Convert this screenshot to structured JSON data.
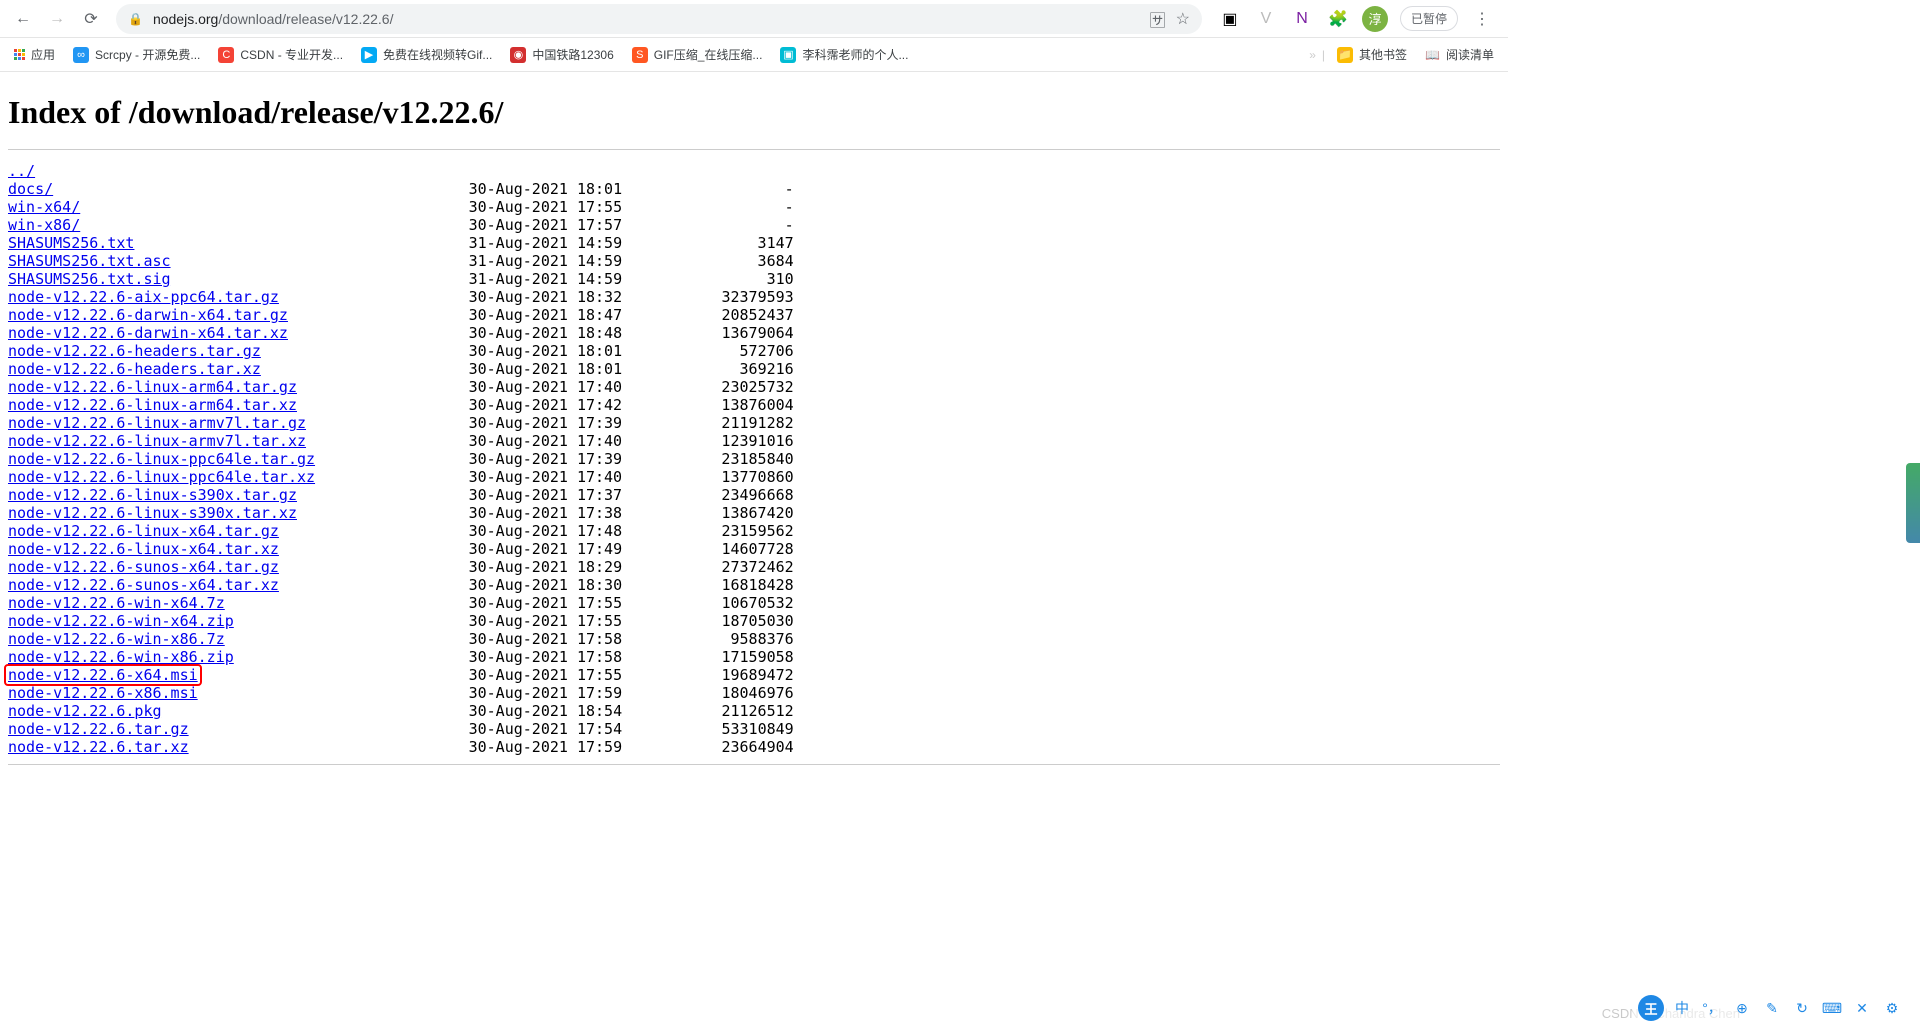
{
  "browser": {
    "url_domain": "nodejs.org",
    "url_path": "/download/release/v12.22.6/",
    "pause_label": "已暂停",
    "avatar_char": "淳"
  },
  "bookmarks": {
    "apps": "应用",
    "items": [
      {
        "label": "Scrcpy - 开源免费...",
        "icon_bg": "#2196f3",
        "icon_char": "∞"
      },
      {
        "label": "CSDN - 专业开发...",
        "icon_bg": "#f44336",
        "icon_char": "C"
      },
      {
        "label": "免费在线视频转Gif...",
        "icon_bg": "#03a9f4",
        "icon_char": "▶"
      },
      {
        "label": "中国铁路12306",
        "icon_bg": "#d32f2f",
        "icon_char": "◉"
      },
      {
        "label": "GIF压缩_在线压缩...",
        "icon_bg": "#ff5722",
        "icon_char": "S"
      },
      {
        "label": "李科霈老师的个人...",
        "icon_bg": "#00bcd4",
        "icon_char": "▣"
      }
    ],
    "other": "其他书签",
    "reading": "阅读清单"
  },
  "page": {
    "title": "Index of /download/release/v12.22.6/",
    "parent": "../",
    "highlighted": "node-v12.22.6-x64.msi",
    "entries": [
      {
        "name": "docs/",
        "date": "30-Aug-2021 18:01",
        "size": "-"
      },
      {
        "name": "win-x64/",
        "date": "30-Aug-2021 17:55",
        "size": "-"
      },
      {
        "name": "win-x86/",
        "date": "30-Aug-2021 17:57",
        "size": "-"
      },
      {
        "name": "SHASUMS256.txt",
        "date": "31-Aug-2021 14:59",
        "size": "3147"
      },
      {
        "name": "SHASUMS256.txt.asc",
        "date": "31-Aug-2021 14:59",
        "size": "3684"
      },
      {
        "name": "SHASUMS256.txt.sig",
        "date": "31-Aug-2021 14:59",
        "size": "310"
      },
      {
        "name": "node-v12.22.6-aix-ppc64.tar.gz",
        "date": "30-Aug-2021 18:32",
        "size": "32379593"
      },
      {
        "name": "node-v12.22.6-darwin-x64.tar.gz",
        "date": "30-Aug-2021 18:47",
        "size": "20852437"
      },
      {
        "name": "node-v12.22.6-darwin-x64.tar.xz",
        "date": "30-Aug-2021 18:48",
        "size": "13679064"
      },
      {
        "name": "node-v12.22.6-headers.tar.gz",
        "date": "30-Aug-2021 18:01",
        "size": "572706"
      },
      {
        "name": "node-v12.22.6-headers.tar.xz",
        "date": "30-Aug-2021 18:01",
        "size": "369216"
      },
      {
        "name": "node-v12.22.6-linux-arm64.tar.gz",
        "date": "30-Aug-2021 17:40",
        "size": "23025732"
      },
      {
        "name": "node-v12.22.6-linux-arm64.tar.xz",
        "date": "30-Aug-2021 17:42",
        "size": "13876004"
      },
      {
        "name": "node-v12.22.6-linux-armv7l.tar.gz",
        "date": "30-Aug-2021 17:39",
        "size": "21191282"
      },
      {
        "name": "node-v12.22.6-linux-armv7l.tar.xz",
        "date": "30-Aug-2021 17:40",
        "size": "12391016"
      },
      {
        "name": "node-v12.22.6-linux-ppc64le.tar.gz",
        "date": "30-Aug-2021 17:39",
        "size": "23185840"
      },
      {
        "name": "node-v12.22.6-linux-ppc64le.tar.xz",
        "date": "30-Aug-2021 17:40",
        "size": "13770860"
      },
      {
        "name": "node-v12.22.6-linux-s390x.tar.gz",
        "date": "30-Aug-2021 17:37",
        "size": "23496668"
      },
      {
        "name": "node-v12.22.6-linux-s390x.tar.xz",
        "date": "30-Aug-2021 17:38",
        "size": "13867420"
      },
      {
        "name": "node-v12.22.6-linux-x64.tar.gz",
        "date": "30-Aug-2021 17:48",
        "size": "23159562"
      },
      {
        "name": "node-v12.22.6-linux-x64.tar.xz",
        "date": "30-Aug-2021 17:49",
        "size": "14607728"
      },
      {
        "name": "node-v12.22.6-sunos-x64.tar.gz",
        "date": "30-Aug-2021 18:29",
        "size": "27372462"
      },
      {
        "name": "node-v12.22.6-sunos-x64.tar.xz",
        "date": "30-Aug-2021 18:30",
        "size": "16818428"
      },
      {
        "name": "node-v12.22.6-win-x64.7z",
        "date": "30-Aug-2021 17:55",
        "size": "10670532"
      },
      {
        "name": "node-v12.22.6-win-x64.zip",
        "date": "30-Aug-2021 17:55",
        "size": "18705030"
      },
      {
        "name": "node-v12.22.6-win-x86.7z",
        "date": "30-Aug-2021 17:58",
        "size": "9588376"
      },
      {
        "name": "node-v12.22.6-win-x86.zip",
        "date": "30-Aug-2021 17:58",
        "size": "17159058"
      },
      {
        "name": "node-v12.22.6-x64.msi",
        "date": "30-Aug-2021 17:55",
        "size": "19689472"
      },
      {
        "name": "node-v12.22.6-x86.msi",
        "date": "30-Aug-2021 17:59",
        "size": "18046976"
      },
      {
        "name": "node-v12.22.6.pkg",
        "date": "30-Aug-2021 18:54",
        "size": "21126512"
      },
      {
        "name": "node-v12.22.6.tar.gz",
        "date": "30-Aug-2021 17:54",
        "size": "53310849"
      },
      {
        "name": "node-v12.22.6.tar.xz",
        "date": "30-Aug-2021 17:59",
        "size": "23664904"
      }
    ]
  },
  "watermark": "CSDN @Chandra Chen",
  "bottom_circle": "王"
}
